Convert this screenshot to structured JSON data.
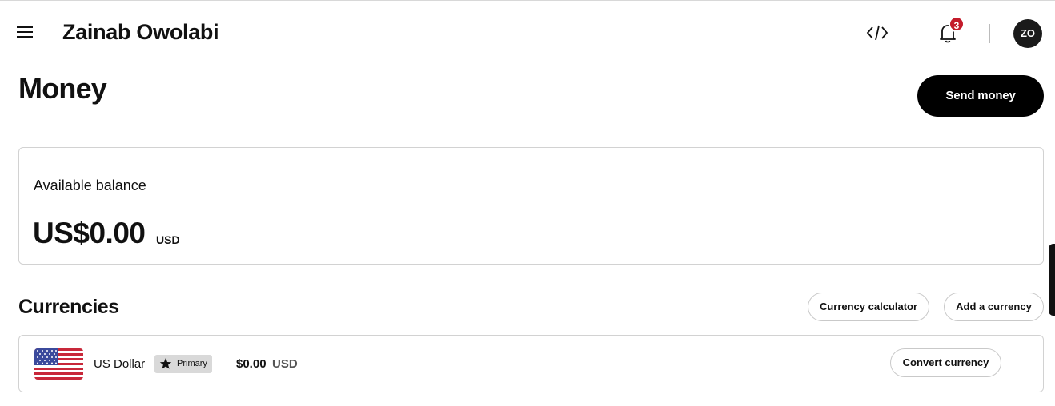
{
  "header": {
    "menu_icon": "hamburger-menu-icon",
    "user_name": "Zainab Owolabi",
    "code_icon": "code-brackets-icon",
    "bell_icon": "notification-bell-icon",
    "notification_count": "3",
    "avatar_initials": "ZO"
  },
  "page": {
    "title": "Money",
    "send_button": "Send money"
  },
  "balance": {
    "label": "Available balance",
    "amount": "US$0.00",
    "currency_code": "USD"
  },
  "currencies": {
    "title": "Currencies",
    "calculator_button": "Currency calculator",
    "add_button": "Add a currency",
    "items": [
      {
        "flag_icon": "us-flag-icon",
        "name": "US Dollar",
        "tag": "Primary",
        "amount": "$0.00",
        "code": "USD",
        "convert_button": "Convert currency"
      }
    ]
  },
  "colors": {
    "accent": "#000000",
    "badge": "#c41b2b",
    "tag_bg": "#d9d9d9"
  }
}
